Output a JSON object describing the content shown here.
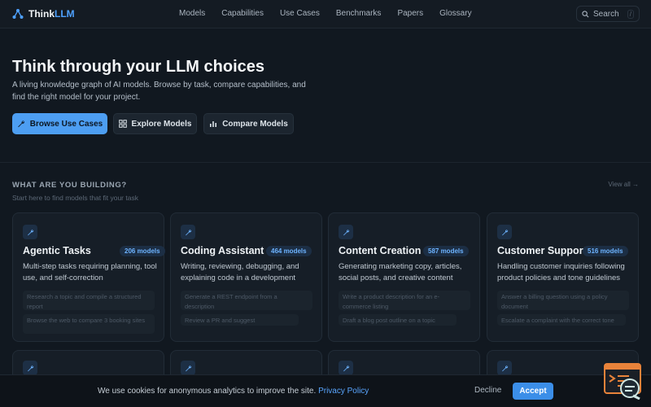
{
  "brand": {
    "name_white": "Think",
    "name_accent": "LLM"
  },
  "nav": {
    "links": [
      "Models",
      "Capabilities",
      "Use Cases",
      "Benchmarks",
      "Papers",
      "Glossary"
    ]
  },
  "search": {
    "label": "Search",
    "shortcut": "/"
  },
  "hero": {
    "title": "Think through your LLM choices",
    "subtitle": "A living knowledge graph of AI models. Browse by task, compare capabilities, and find the right model for your project.",
    "buttons": {
      "browse": "Browse Use Cases",
      "explore": "Explore Models",
      "compare": "Compare Models"
    }
  },
  "section": {
    "title": "WHAT ARE YOU BUILDING?",
    "subtitle": "Start here to find models that fit your task",
    "view_all": "View all →"
  },
  "cards": [
    {
      "title": "Agentic Tasks",
      "badge": "206 models",
      "description": "Multi-step tasks requiring planning, tool use, and self-correction",
      "examples": [
        "Research a topic and compile a structured report",
        "Browse the web to compare 3 booking sites"
      ]
    },
    {
      "title": "Coding Assistant",
      "badge": "464 models",
      "description": "Writing, reviewing, debugging, and explaining code in a development workflow",
      "examples": [
        "Generate a REST endpoint from a description",
        "Review a PR and suggest improvements"
      ]
    },
    {
      "title": "Content Creation",
      "badge": "587 models",
      "description": "Generating marketing copy, articles, social posts, and creative content",
      "examples": [
        "Write a product description for an e-commerce listing",
        "Draft a blog post outline on a topic"
      ]
    },
    {
      "title": "Customer Support",
      "badge": "516 models",
      "description": "Handling customer inquiries following product policies and tone guidelines",
      "examples": [
        "Answer a billing question using a policy document",
        "Escalate a complaint with the correct tone"
      ]
    }
  ],
  "cookie": {
    "text": "We use cookies for anonymous analytics to improve the site.",
    "link": "Privacy Policy",
    "decline": "Decline",
    "accept": "Accept"
  },
  "colors": {
    "accent": "#4d9ef2",
    "background": "#111820",
    "card": "#161e27",
    "badge_text": "#6db3ff",
    "chat_widget": "#e8833a"
  },
  "icons": {
    "logo": "network-icon",
    "search": "search-icon",
    "card": "wrench-icon",
    "explore": "grid-icon",
    "compare": "bar-chart-icon",
    "chat": "chat-widget-icon"
  }
}
